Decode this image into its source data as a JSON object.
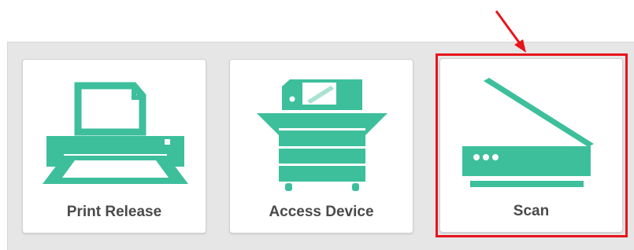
{
  "colors": {
    "accent": "#3dbf9c",
    "highlight": "#e8141c",
    "label": "#4a4a4a",
    "panel_bg": "#e6e6e6",
    "tile_bg": "#ffffff"
  },
  "tiles": [
    {
      "label": "Print Release",
      "icon": "printer-icon"
    },
    {
      "label": "Access Device",
      "icon": "copier-icon"
    },
    {
      "label": "Scan",
      "icon": "scanner-icon",
      "highlighted": true
    }
  ],
  "annotation": {
    "type": "red-arrow-and-box",
    "target": "Scan"
  }
}
